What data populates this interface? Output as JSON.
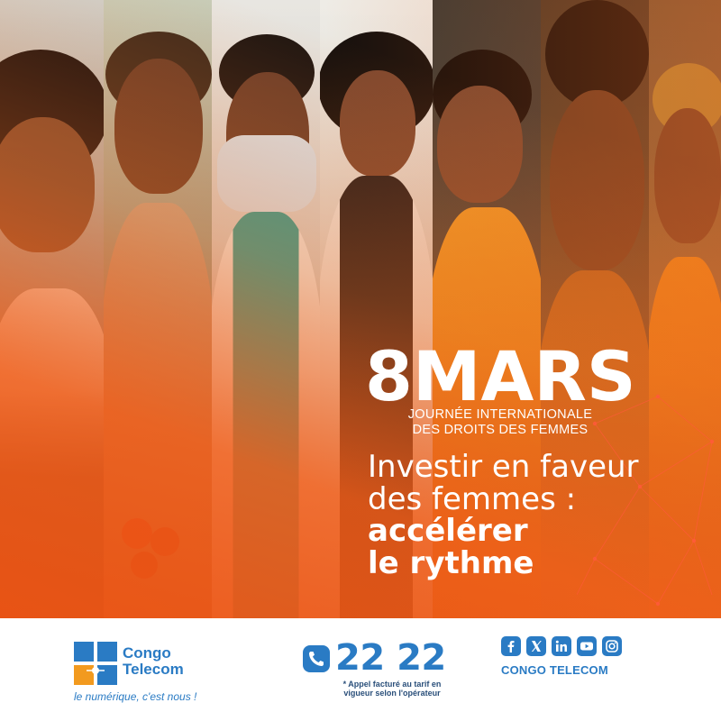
{
  "headline": {
    "title": "8MARS",
    "subtitle_line1": "JOURNÉE INTERNATIONALE",
    "subtitle_line2": "DES DROITS DES FEMMES",
    "slogan_line1": "Investir en faveur",
    "slogan_line2": "des femmes :",
    "slogan_line3": "accélérer",
    "slogan_line4": "le rythme"
  },
  "footer": {
    "brand_line1": "Congo",
    "brand_line2": "Telecom",
    "tagline": "le numérique, c'est nous !",
    "phone_number": "22 22",
    "phone_note_line1": "* Appel facturé au tarif en",
    "phone_note_line2": "vigueur selon l'opérateur",
    "social_name": "CONGO TELECOM",
    "social_icons": [
      "facebook-icon",
      "x-icon",
      "linkedin-icon",
      "youtube-icon",
      "instagram-icon"
    ]
  },
  "colors": {
    "accent_orange": "#f05a1e",
    "brand_blue": "#2a7bc4",
    "white": "#ffffff"
  }
}
